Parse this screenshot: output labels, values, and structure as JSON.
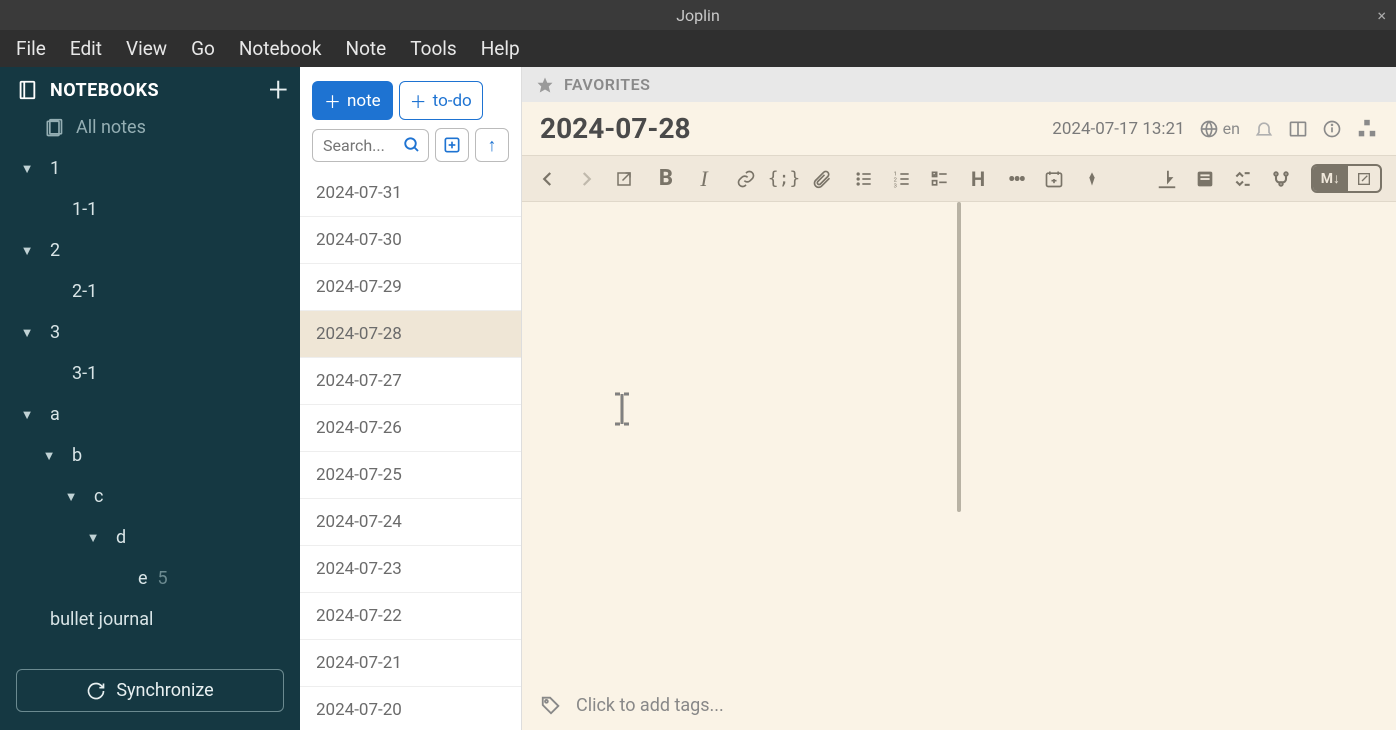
{
  "window": {
    "title": "Joplin"
  },
  "menubar": [
    "File",
    "Edit",
    "View",
    "Go",
    "Notebook",
    "Note",
    "Tools",
    "Help"
  ],
  "sidebar": {
    "header": "NOTEBOOKS",
    "allnotes": "All notes",
    "sync": "Synchronize",
    "tree": [
      {
        "label": "1",
        "indent": 0,
        "chev": true
      },
      {
        "label": "1-1",
        "indent": 1,
        "chev": false
      },
      {
        "label": "2",
        "indent": 0,
        "chev": true
      },
      {
        "label": "2-1",
        "indent": 1,
        "chev": false
      },
      {
        "label": "3",
        "indent": 0,
        "chev": true
      },
      {
        "label": "3-1",
        "indent": 1,
        "chev": false
      },
      {
        "label": "a",
        "indent": 0,
        "chev": true
      },
      {
        "label": "b",
        "indent": 1,
        "chev": true
      },
      {
        "label": "c",
        "indent": 2,
        "chev": true
      },
      {
        "label": "d",
        "indent": 3,
        "chev": true
      },
      {
        "label": "e",
        "indent": 4,
        "chev": false,
        "count": "5"
      },
      {
        "label": "bullet journal",
        "indent": 0,
        "chev": false
      }
    ]
  },
  "notelist": {
    "new_note": "note",
    "new_todo": "to-do",
    "search_placeholder": "Search...",
    "items": [
      "2024-07-31",
      "2024-07-30",
      "2024-07-29",
      "2024-07-28",
      "2024-07-27",
      "2024-07-26",
      "2024-07-25",
      "2024-07-24",
      "2024-07-23",
      "2024-07-22",
      "2024-07-21",
      "2024-07-20"
    ],
    "selected_index": 3
  },
  "editor": {
    "favorites_label": "FAVORITES",
    "title": "2024-07-28",
    "timestamp": "2024-07-17 13:21",
    "lang": "en",
    "md_label": "M↓",
    "tags_placeholder": "Click to add tags..."
  }
}
